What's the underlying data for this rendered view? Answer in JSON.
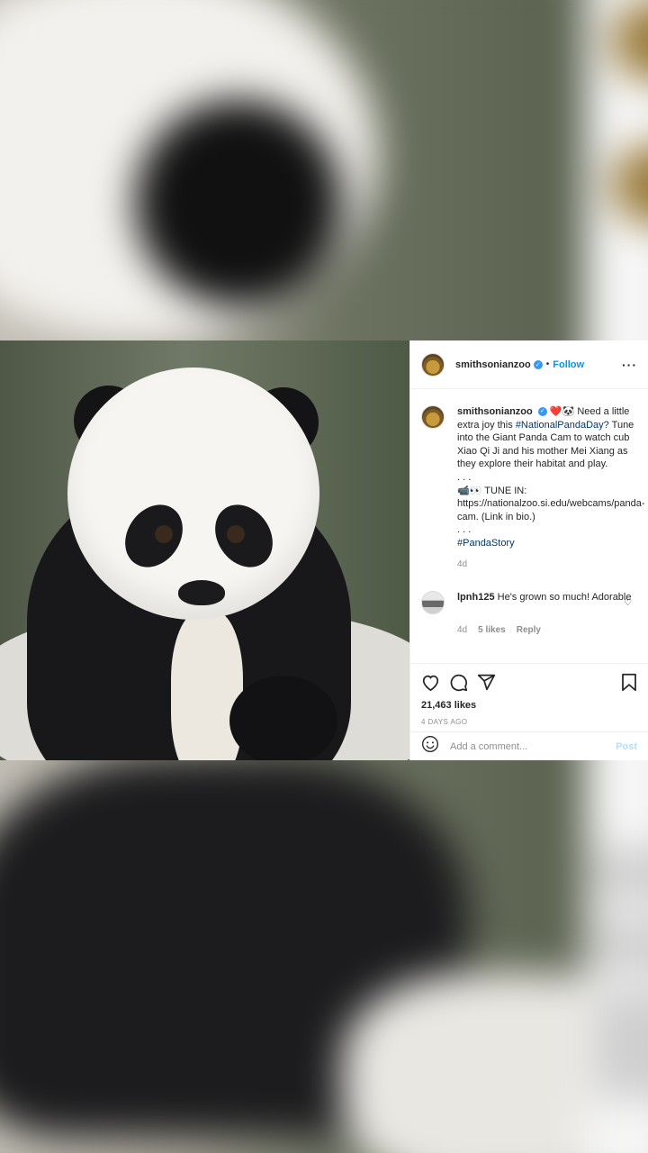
{
  "post": {
    "username": "smithsonianzoo",
    "follow_label": "Follow",
    "separator": "•",
    "more_label": "···",
    "caption": {
      "username": "smithsonianzoo",
      "emojis": "❤️🐼",
      "line1": "Need a little extra joy this",
      "hashtag1": "#NationalPandaDay?",
      "line2": "Tune into the Giant Panda Cam to watch cub Xiao Qi Ji and his mother Mei Xiang as they explore their habitat and play.",
      "dots1": ". . .",
      "tune_in": "📹👀 TUNE IN: https://nationalzoo.si.edu/webcams/panda-cam. (Link in bio.)",
      "dots2": ". . .",
      "hashtag2": "#PandaStory",
      "time": "4d"
    },
    "comment": {
      "username": "lpnh125",
      "text": "He's grown so much! Adorable",
      "time": "4d",
      "likes": "5 likes",
      "reply": "Reply"
    },
    "likes_count": "21,463 likes",
    "posted_ago": "4 DAYS AGO",
    "add_comment_placeholder": "Add a comment...",
    "post_button": "Post"
  },
  "colors": {
    "link_blue": "#0095f6",
    "hashtag": "#00376b",
    "muted": "#8e8e8e",
    "verified": "#3897f0"
  },
  "icons": [
    "verified-badge-icon",
    "more-icon",
    "heart-icon",
    "comment-icon",
    "share-icon",
    "bookmark-icon",
    "emoji-icon"
  ]
}
